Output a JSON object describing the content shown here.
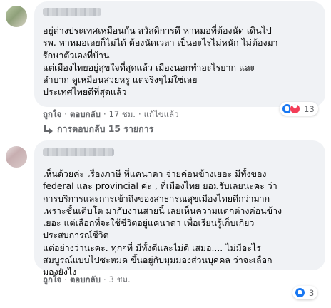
{
  "comments": [
    {
      "text": "อยู่ต่างประเทศเหมือนกัน สวัสดิการดี หาหมอที่ต้องนัด เดินไป\nรพ. หาหมอเลยก็ไม่ได้ ต้องนัดเวลา เป็นอะไรไม่หนัก ไม่ต้องมา\nรักษาตัวเองที่บ้าน\nแต่เมืองไทยอยู่สุขใจที่สุดแล้ว เมืองนอกทำอะไรยาก และ\nลำบาก ดูเหมือนสวยหรู แต่จริงๆไม่ใช่เลย\nประเทศไทยดีที่สุดแล้ว",
      "like_label": "ถูกใจ",
      "reply_label": "ตอบกลับ",
      "time": "17 ชม.",
      "edited_label": "แก้ไขแล้ว",
      "reaction_count": "13"
    },
    {
      "text": "เห็นด้วยค่ะ เรื่องภาษี ที่แคนาดา จ่ายค่อนข้างเยอะ มีทั้งของ\nfederal และ provincial ค่ะ , ที่เมืองไทย ยอมรับเลยนะคะ ว่า\nการบริการและการเข้าถึงของสาธารณสุขเมืองไทยดีกว่ามาก\nเพราะชั้นเติบโต มากับงานสายนี้ เลยเห็นความแตกต่างค่อนข้าง\nเยอะ แต่เลือกที่จะใช้ชีวิตอยู่แคนาดา เพื่อเรียนรู้เก็บเกี่ยว\nประสบการณ์ชีวิต\nแต่อย่างว่านะคะ. ทุกๆที่ มีทั้งดีและไม่ดี เสมอ.... ไม่มีอะไร\nสมบูรณ์แบบไปซะหมด ขึ้นอยู่กับมุมมองส่วนบุคคล ว่าจะเลือก\nมองยังไง",
      "like_label": "ถูกใจ",
      "reply_label": "ตอบกลับ",
      "time": "3 ชม.",
      "reaction_count": "3"
    }
  ],
  "replies_link": "การตอบกลับ 15 รายการ",
  "separator": "·",
  "colors": {
    "bubble": "#f0f2f5",
    "secondary_text": "#65676b",
    "like_blue": "#1877f2",
    "love_red": "#f33e58"
  },
  "icons": {
    "like": "thumbs-up-icon",
    "love": "heart-icon",
    "reply_arrow": "reply-arrow-icon"
  }
}
